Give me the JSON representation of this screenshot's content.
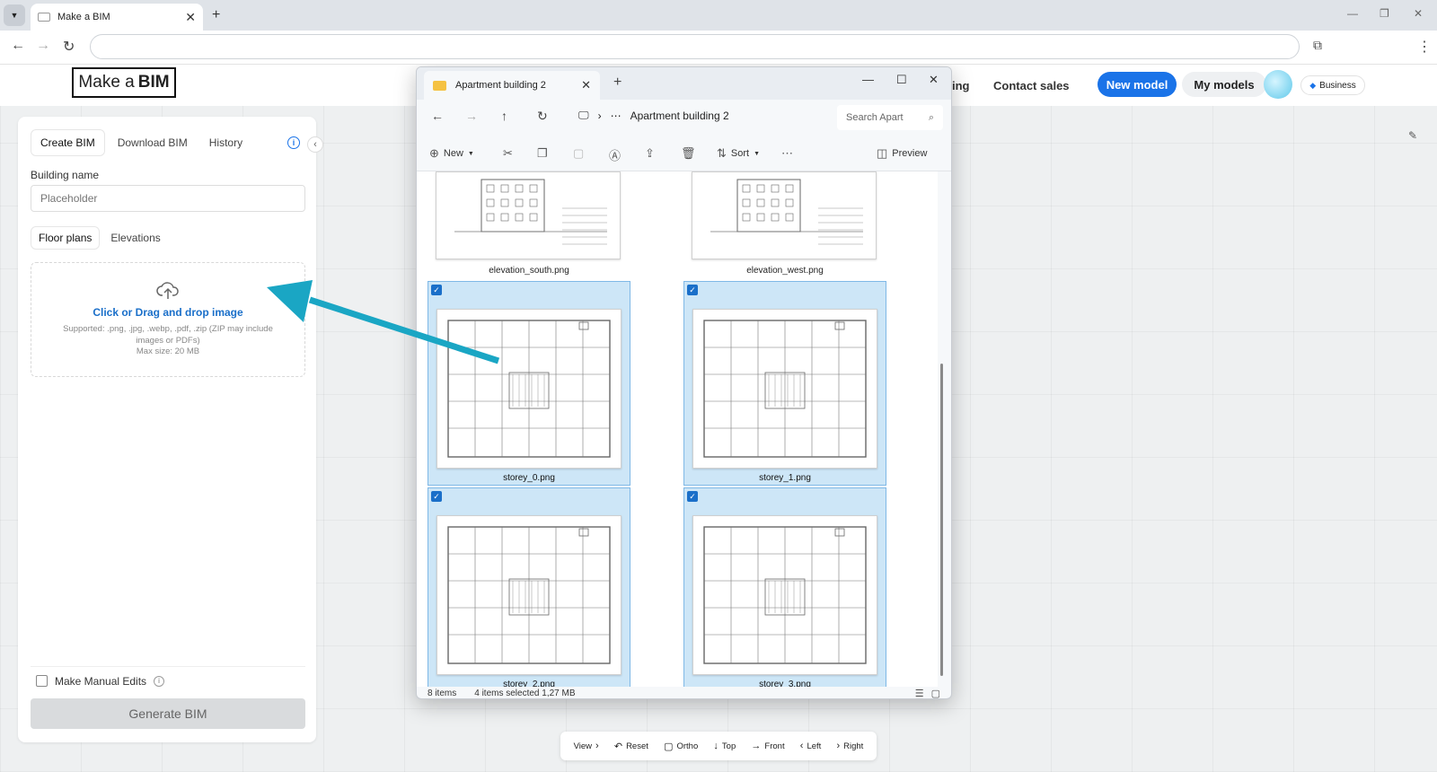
{
  "browser": {
    "tab_title": "Make a BIM"
  },
  "header": {
    "logo_prefix": "Make a",
    "logo_bold": "BIM",
    "links": {
      "pricing_partial": "ing",
      "contact_sales": "Contact sales"
    },
    "new_model": "New model",
    "my_models": "My models",
    "business": "Business"
  },
  "panel": {
    "tabs": [
      "Create BIM",
      "Download BIM",
      "History"
    ],
    "building_name_label": "Building name",
    "building_name_placeholder": "Placeholder",
    "subtabs": [
      "Floor plans",
      "Elevations"
    ],
    "drop_title": "Click or Drag and drop image",
    "drop_supported": "Supported: .png, .jpg, .webp, .pdf, .zip (ZIP may include images or PDFs)",
    "drop_maxsize": "Max size: 20 MB",
    "manual_edits": "Make Manual Edits",
    "generate": "Generate BIM"
  },
  "explorer": {
    "tab_title": "Apartment building 2",
    "breadcrumb": "Apartment building 2",
    "search_placeholder": "Search Apart",
    "commands": {
      "new": "New",
      "sort": "Sort",
      "preview": "Preview"
    },
    "files": [
      {
        "name": "elevation_south.png",
        "selected": false
      },
      {
        "name": "elevation_west.png",
        "selected": false
      },
      {
        "name": "storey_0.png",
        "selected": true
      },
      {
        "name": "storey_1.png",
        "selected": true
      },
      {
        "name": "storey_2.png",
        "selected": true
      },
      {
        "name": "storey_3.png",
        "selected": true
      }
    ],
    "status": {
      "items": "8 items",
      "selected": "4 items selected  1,27 MB"
    }
  },
  "viewbar": {
    "view": "View",
    "reset": "Reset",
    "ortho": "Ortho",
    "top": "Top",
    "front": "Front",
    "left": "Left",
    "right": "Right"
  },
  "colors": {
    "accent": "#1a73e8",
    "selection": "#cde6f7",
    "arrow": "#1aa6c4"
  }
}
